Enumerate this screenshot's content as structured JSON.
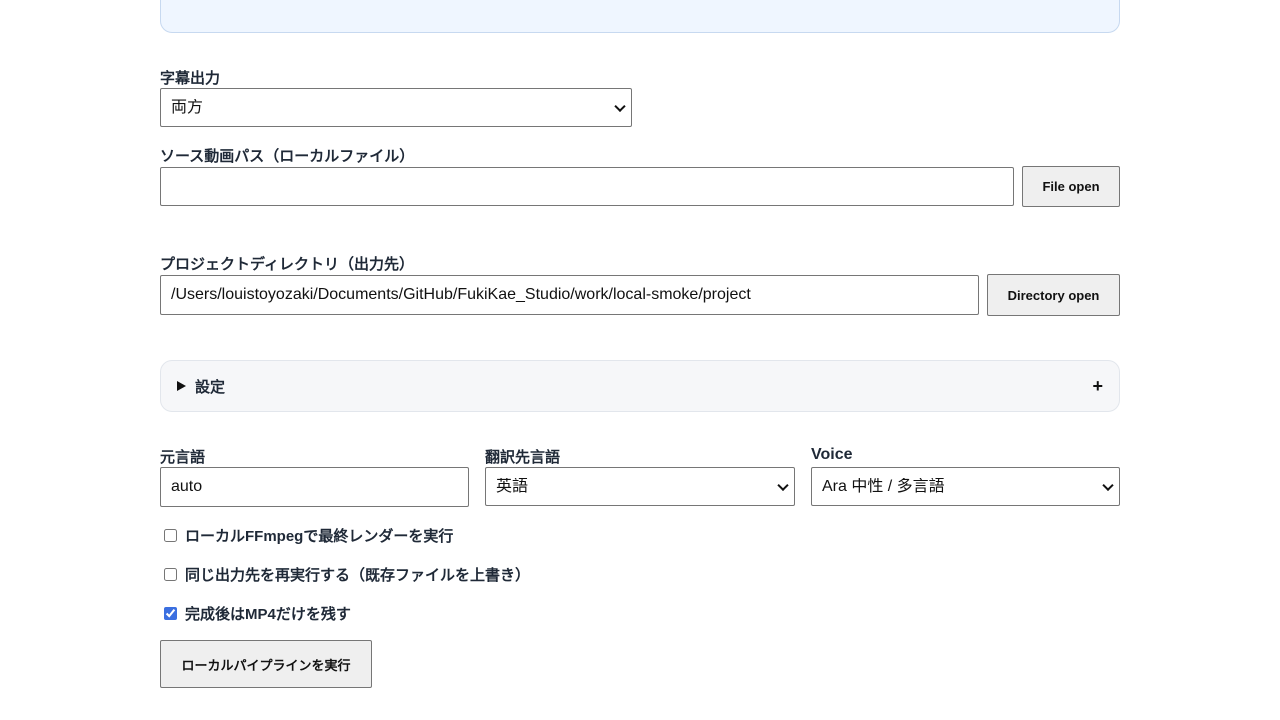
{
  "subtitle_output": {
    "label": "字幕出力",
    "selected": "両方"
  },
  "source_video": {
    "label": "ソース動画パス（ローカルファイル）",
    "value": "",
    "button_label": "File open"
  },
  "project_dir": {
    "label": "プロジェクトディレクトリ（出力先）",
    "value": "/Users/louistoyozaki/Documents/GitHub/FukiKae_Studio/work/local-smoke/project",
    "button_label": "Directory open"
  },
  "settings": {
    "summary_label": "設定",
    "toggle_symbol": "+"
  },
  "source_language": {
    "label": "元言語",
    "value": "auto"
  },
  "target_language": {
    "label": "翻訳先言語",
    "selected": "英語"
  },
  "voice": {
    "label": "Voice",
    "selected": "Ara 中性 / 多言語"
  },
  "options": [
    {
      "label": "ローカルFFmpegで最終レンダーを実行",
      "checked": false
    },
    {
      "label": "同じ出力先を再実行する（既存ファイルを上書き）",
      "checked": false
    },
    {
      "label": "完成後はMP4だけを残す",
      "checked": true
    }
  ],
  "run_button": {
    "label": "ローカルパイプラインを実行"
  }
}
